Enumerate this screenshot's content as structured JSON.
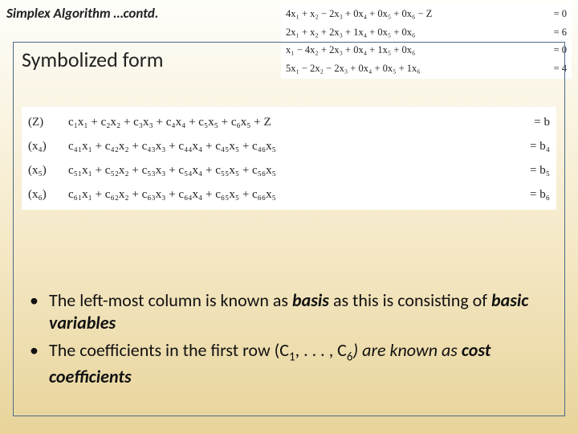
{
  "slide": {
    "title": "Simplex Algorithm …contd.",
    "subheading": "Symbolized form"
  },
  "top_equations": {
    "rows": [
      {
        "lhs": "4x₁ + x₂ − 2x₃ + 0x₄ + 0x₅ + 0x₆ − Z",
        "rhs": "= 0"
      },
      {
        "lhs": "2x₁ + x₂ + 2x₃ + 1x₄ + 0x₅ + 0x₆",
        "rhs": "= 6"
      },
      {
        "lhs": "x₁ − 4x₂ + 2x₃ + 0x₄ + 1x₅ + 0x₆",
        "rhs": "= 0"
      },
      {
        "lhs": "5x₁ − 2x₂ − 2x₃ + 0x₄ + 0x₅ + 1x₆",
        "rhs": "= 4"
      }
    ]
  },
  "symbolized": {
    "rows": [
      {
        "label": "(Z)",
        "expr": "c₁x₁  + c₂x₂  + c₃x₃  +  c₄x₄  +  c₅x₅  + c₆x₅   + Z",
        "rhs": "= b"
      },
      {
        "label": "(x₄)",
        "expr": "c₄₁x₁ + c₄₂x₂ + c₄₃x₃ +  c₄₄x₄ +  c₄₅x₅ + c₄₆x₅",
        "rhs": "= b₄"
      },
      {
        "label": "(x₅)",
        "expr": "c₅₁x₁ + c₅₂x₂ + c₅₃x₃ +  c₅₄x₄ +  c₅₅x₅ + c₅₆x₅",
        "rhs": "= b₅"
      },
      {
        "label": "(x₆)",
        "expr": "c₆₁x₁ + c₆₂x₂ + c₆₃x₃ +  c₆₄x₄ +  c₆₅x₅ + c₆₆x₅",
        "rhs": "= b₆"
      }
    ]
  },
  "notes": {
    "items": [
      {
        "pre": "The left-most column is known as ",
        "bold1": "basis",
        "mid": " as this is consisting of ",
        "bold2": "basic variables",
        "post": ""
      },
      {
        "pre": "The coefficients in the first row (C",
        "s1": "1",
        "mid": ", . . . , C",
        "s2": "6",
        "post": ") are known as ",
        "bold1": "cost coefficients"
      }
    ]
  }
}
